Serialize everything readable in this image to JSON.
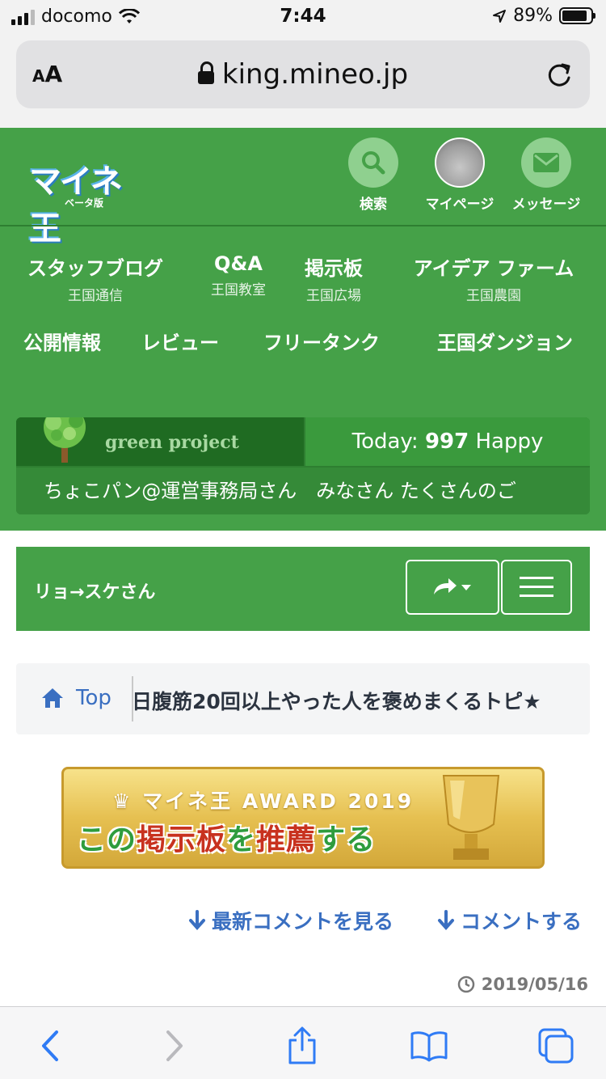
{
  "status_bar": {
    "carrier": "docomo",
    "time": "7:44",
    "battery": "89%"
  },
  "browser": {
    "aa": "AA",
    "url": "king.mineo.jp"
  },
  "header": {
    "logo_text": "マイネ王",
    "logo_sub": "ベータ版",
    "buttons": [
      {
        "label": "検索"
      },
      {
        "label": "マイページ"
      },
      {
        "label": "メッセージ"
      }
    ],
    "nav_row1": [
      {
        "main": "スタッフブログ",
        "sub": "王国通信"
      },
      {
        "main": "Q&A",
        "sub": "王国教室"
      },
      {
        "main": "掲示板",
        "sub": "王国広場"
      },
      {
        "main": "アイデア ファーム",
        "sub": "王国農園"
      }
    ],
    "nav_row2": [
      {
        "main": "公開情報"
      },
      {
        "main": "レビュー"
      },
      {
        "main": "フリータンク"
      },
      {
        "main": "王国ダンジョン"
      }
    ],
    "green_project": "green project",
    "today_label": "Today: ",
    "today_count": "997",
    "today_suffix": " Happy",
    "ticker": "ちょこパン@運営事務局さん　みなさん たくさんのご"
  },
  "userbar": {
    "username": "リョ→スケさん"
  },
  "breadcrumb": {
    "home": "Top",
    "title": "日腹筋20回以上やった人を褒めまくるトピ★"
  },
  "award": {
    "top": "マイネ王 AWARD 2019",
    "main_a": "この",
    "main_b": "掲示板",
    "main_c": "を",
    "main_d": "推薦",
    "main_e": "する"
  },
  "links": {
    "latest": "最新コメントを見る",
    "comment": "コメントする"
  },
  "date": "2019/05/16",
  "colors": {
    "green": "#45a148",
    "link_blue": "#3a6fc1",
    "ios_blue": "#2f7bf5"
  }
}
